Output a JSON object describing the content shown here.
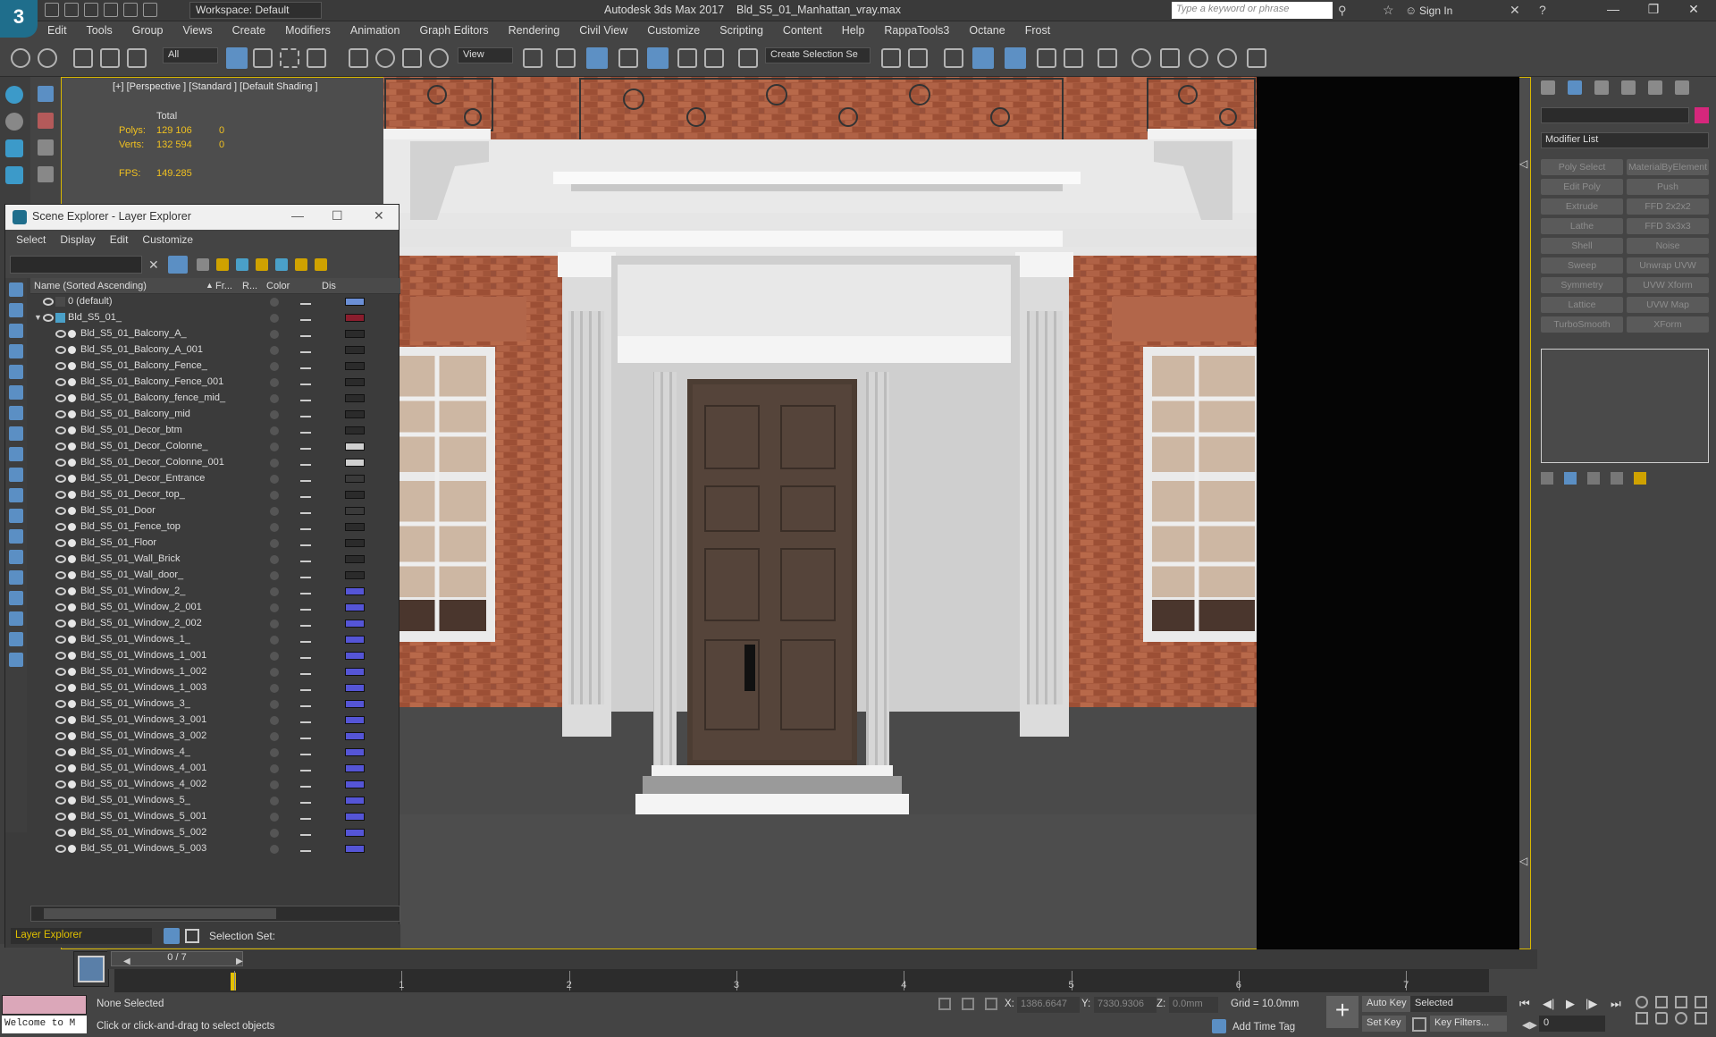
{
  "app": {
    "title": "Autodesk 3ds Max 2017",
    "file": "Bld_S5_01_Manhattan_vray.max",
    "workspace": "Workspace: Default",
    "search_placeholder": "Type a keyword or phrase",
    "sign_in": "Sign In"
  },
  "menu": [
    "Edit",
    "Tools",
    "Group",
    "Views",
    "Create",
    "Modifiers",
    "Animation",
    "Graph Editors",
    "Rendering",
    "Civil View",
    "Customize",
    "Scripting",
    "Content",
    "Help",
    "RappaTools3",
    "Octane",
    "Frost"
  ],
  "toolbar": {
    "selection_filter": "All",
    "coord_system": "View",
    "selection_set": "Create Selection Se"
  },
  "viewport": {
    "label": "[+] [Perspective ] [Standard ] [Default Shading ]",
    "stats": {
      "total_label": "Total",
      "polys_label": "Polys:",
      "polys_value": "129 106",
      "polys_sel": "0",
      "verts_label": "Verts:",
      "verts_value": "132 594",
      "verts_sel": "0",
      "fps_label": "FPS:",
      "fps_value": "149.285"
    }
  },
  "scene_explorer": {
    "title": "Scene Explorer - Layer Explorer",
    "menu": [
      "Select",
      "Display",
      "Edit",
      "Customize"
    ],
    "columns": {
      "name": "Name (Sorted Ascending)",
      "frozen": "Fr...",
      "render": "R...",
      "color": "Color",
      "display": "Dis"
    },
    "layers": [
      {
        "name": "0 (default)",
        "level": 0,
        "color": "#6b8fd6"
      },
      {
        "name": "Bld_S5_01_",
        "level": 0,
        "color": "#8a1d2d"
      },
      {
        "name": "Bld_S5_01_Balcony_A_",
        "level": 1,
        "color": "#2b2b2b"
      },
      {
        "name": "Bld_S5_01_Balcony_A_001",
        "level": 1,
        "color": "#2b2b2b"
      },
      {
        "name": "Bld_S5_01_Balcony_Fence_",
        "level": 1,
        "color": "#2b2b2b"
      },
      {
        "name": "Bld_S5_01_Balcony_Fence_001",
        "level": 1,
        "color": "#2b2b2b"
      },
      {
        "name": "Bld_S5_01_Balcony_fence_mid_",
        "level": 1,
        "color": "#2b2b2b"
      },
      {
        "name": "Bld_S5_01_Balcony_mid",
        "level": 1,
        "color": "#2b2b2b"
      },
      {
        "name": "Bld_S5_01_Decor_btm",
        "level": 1,
        "color": "#2b2b2b"
      },
      {
        "name": "Bld_S5_01_Decor_Colonne_",
        "level": 1,
        "color": "#cfcfcf"
      },
      {
        "name": "Bld_S5_01_Decor_Colonne_001",
        "level": 1,
        "color": "#cfcfcf"
      },
      {
        "name": "Bld_S5_01_Decor_Entrance",
        "level": 1,
        "color": "#3a3a3a"
      },
      {
        "name": "Bld_S5_01_Decor_top_",
        "level": 1,
        "color": "#2b2b2b"
      },
      {
        "name": "Bld_S5_01_Door",
        "level": 1,
        "color": "#3a3a3a"
      },
      {
        "name": "Bld_S5_01_Fence_top",
        "level": 1,
        "color": "#2b2b2b"
      },
      {
        "name": "Bld_S5_01_Floor",
        "level": 1,
        "color": "#2b2b2b"
      },
      {
        "name": "Bld_S5_01_Wall_Brick",
        "level": 1,
        "color": "#2b2b2b"
      },
      {
        "name": "Bld_S5_01_Wall_door_",
        "level": 1,
        "color": "#2b2b2b"
      },
      {
        "name": "Bld_S5_01_Window_2_",
        "level": 1,
        "color": "#5555d6"
      },
      {
        "name": "Bld_S5_01_Window_2_001",
        "level": 1,
        "color": "#5555d6"
      },
      {
        "name": "Bld_S5_01_Window_2_002",
        "level": 1,
        "color": "#5555d6"
      },
      {
        "name": "Bld_S5_01_Windows_1_",
        "level": 1,
        "color": "#5555d6"
      },
      {
        "name": "Bld_S5_01_Windows_1_001",
        "level": 1,
        "color": "#5555d6"
      },
      {
        "name": "Bld_S5_01_Windows_1_002",
        "level": 1,
        "color": "#5555d6"
      },
      {
        "name": "Bld_S5_01_Windows_1_003",
        "level": 1,
        "color": "#5555d6"
      },
      {
        "name": "Bld_S5_01_Windows_3_",
        "level": 1,
        "color": "#5555d6"
      },
      {
        "name": "Bld_S5_01_Windows_3_001",
        "level": 1,
        "color": "#5555d6"
      },
      {
        "name": "Bld_S5_01_Windows_3_002",
        "level": 1,
        "color": "#5555d6"
      },
      {
        "name": "Bld_S5_01_Windows_4_",
        "level": 1,
        "color": "#5555d6"
      },
      {
        "name": "Bld_S5_01_Windows_4_001",
        "level": 1,
        "color": "#5555d6"
      },
      {
        "name": "Bld_S5_01_Windows_4_002",
        "level": 1,
        "color": "#5555d6"
      },
      {
        "name": "Bld_S5_01_Windows_5_",
        "level": 1,
        "color": "#5555d6"
      },
      {
        "name": "Bld_S5_01_Windows_5_001",
        "level": 1,
        "color": "#5555d6"
      },
      {
        "name": "Bld_S5_01_Windows_5_002",
        "level": 1,
        "color": "#5555d6"
      },
      {
        "name": "Bld_S5_01_Windows_5_003",
        "level": 1,
        "color": "#5555d6"
      }
    ],
    "explorer_type": "Layer Explorer",
    "selection_set_label": "Selection Set:"
  },
  "command_panel": {
    "modifier_list": "Modifier List",
    "modifiers": [
      "Poly Select",
      "MaterialByElement",
      "Edit Poly",
      "Push",
      "Extrude",
      "FFD 2x2x2",
      "Lathe",
      "FFD 3x3x3",
      "Shell",
      "Noise",
      "Sweep",
      "Unwrap UVW",
      "Symmetry",
      "UVW Xform",
      "Lattice",
      "UVW Map",
      "TurboSmooth",
      "XForm"
    ],
    "object_color": "#d6277c"
  },
  "timeline": {
    "slider": "0 / 7",
    "ticks": [
      "0",
      "1",
      "2",
      "3",
      "4",
      "5",
      "6",
      "7"
    ]
  },
  "status": {
    "maxscript": "Welcome to M",
    "selection": "None Selected",
    "prompt": "Click or click-and-drag to select objects",
    "x_label": "X:",
    "x_value": "1386.6647",
    "y_label": "Y:",
    "y_value": "7330.9306",
    "z_label": "Z:",
    "z_value": "0.0mm",
    "grid": "Grid = 10.0mm",
    "add_time_tag": "Add Time Tag",
    "auto_key": "Auto Key",
    "set_key": "Set Key",
    "selected": "Selected",
    "key_filters": "Key Filters...",
    "frame": "0"
  }
}
